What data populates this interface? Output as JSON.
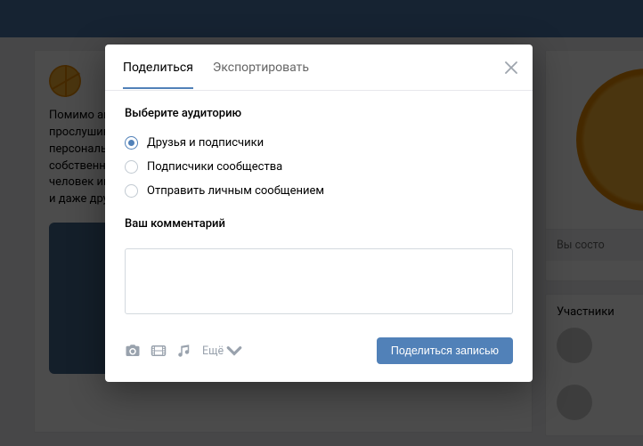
{
  "background": {
    "post_text": "Помимо акт\nпрослушив\nперсональн\nсобственно\nчеловек им\nи даже дру",
    "right_status": "Вы состо",
    "members_label": "Участники"
  },
  "modal": {
    "tabs": {
      "share": "Поделиться",
      "export": "Экспортировать"
    },
    "audience_label": "Выберите аудиторию",
    "options": {
      "friends": "Друзья и подписчики",
      "community": "Подписчики сообщества",
      "pm": "Отправить личным сообщением"
    },
    "comment_label": "Ваш комментарий",
    "comment_value": "",
    "attach_more": "Ещё",
    "submit": "Поделиться записью"
  }
}
